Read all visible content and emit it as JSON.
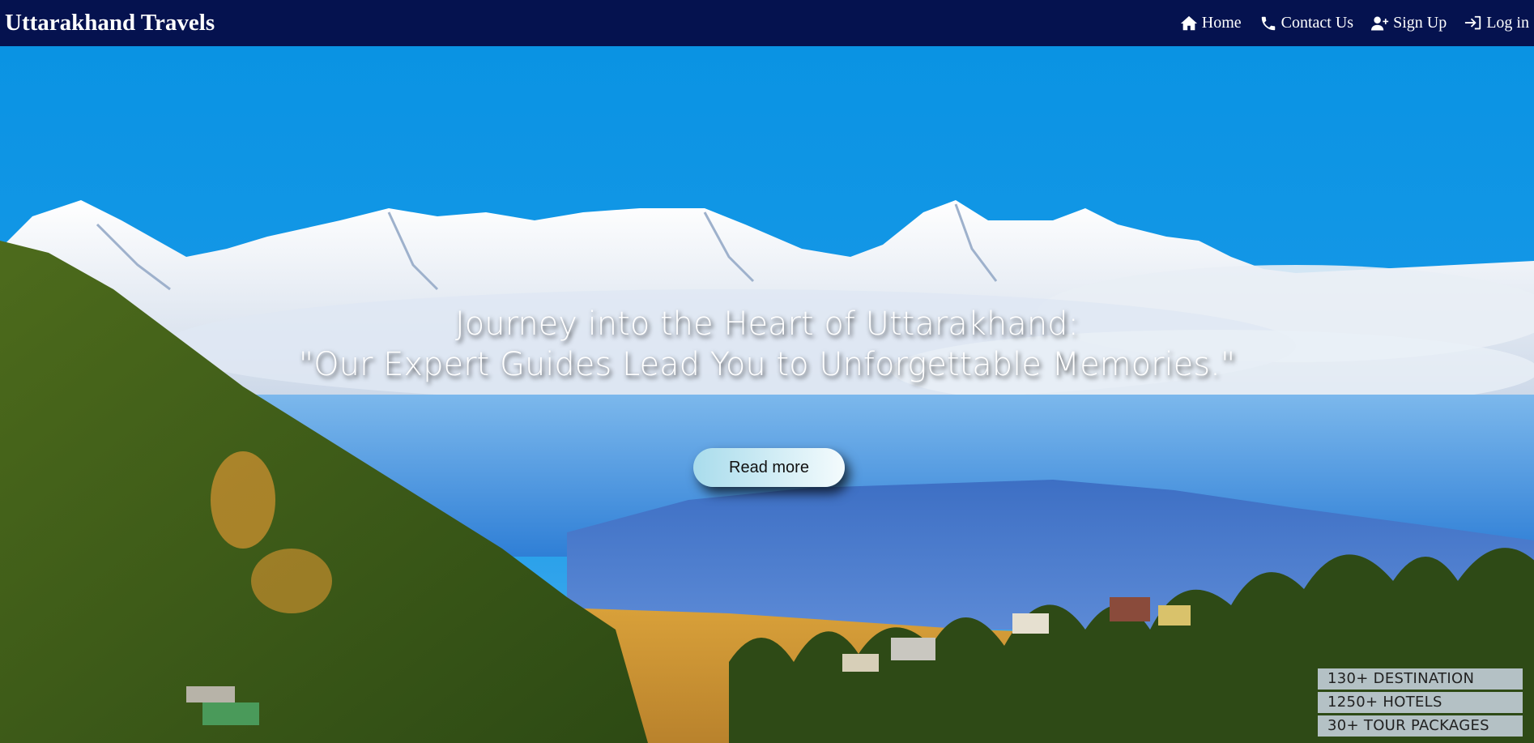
{
  "header": {
    "brand": "Uttarakhand Travels",
    "nav": [
      {
        "label": "Home",
        "icon": "home-icon"
      },
      {
        "label": "Contact Us",
        "icon": "phone-icon"
      },
      {
        "label": "Sign Up",
        "icon": "user-plus-icon"
      },
      {
        "label": "Log in",
        "icon": "login-icon"
      }
    ]
  },
  "hero": {
    "headline_line1": "Journey into the Heart of Uttarakhand:",
    "headline_line2": "\"Our Expert Guides Lead You to Unforgettable Memories.\"",
    "cta_label": "Read more"
  },
  "stats": [
    "130+ DESTINATION",
    "1250+ HOTELS",
    "30+ TOUR PACKAGES"
  ],
  "colors": {
    "navbar": "#05124f",
    "sky": "#0a8fe0",
    "button_gradient_start": "#a9dcec",
    "button_gradient_end": "#f4fbfd"
  }
}
